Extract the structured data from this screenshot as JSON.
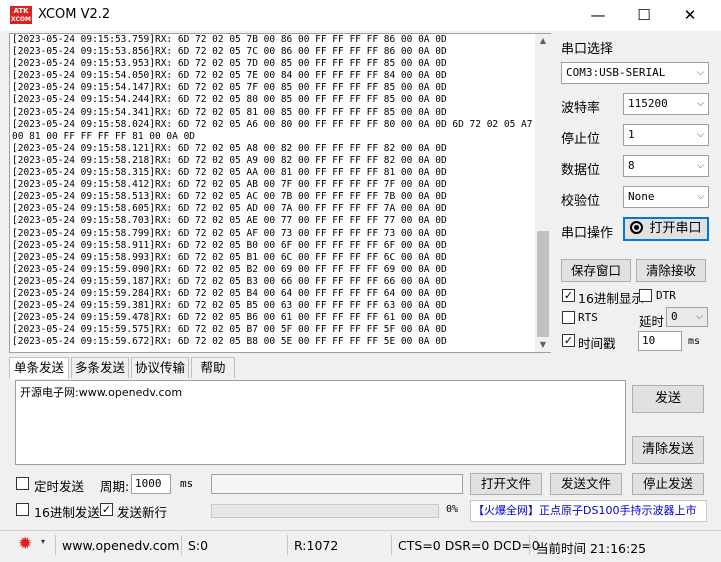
{
  "window": {
    "logo_text": "ATK",
    "logo_sub": "XCOM",
    "title": "XCOM V2.2",
    "min_glyph": "—",
    "max_glyph": "☐",
    "close_glyph": "✕"
  },
  "receive_lines": [
    "[2023-05-24 09:15:53.759]RX: 6D 72 02 05 7B 00 86 00 FF FF FF FF 86 00 0A 0D",
    "[2023-05-24 09:15:53.856]RX: 6D 72 02 05 7C 00 86 00 FF FF FF FF 86 00 0A 0D",
    "[2023-05-24 09:15:53.953]RX: 6D 72 02 05 7D 00 85 00 FF FF FF FF 85 00 0A 0D",
    "[2023-05-24 09:15:54.050]RX: 6D 72 02 05 7E 00 84 00 FF FF FF FF 84 00 0A 0D",
    "[2023-05-24 09:15:54.147]RX: 6D 72 02 05 7F 00 85 00 FF FF FF FF 85 00 0A 0D",
    "[2023-05-24 09:15:54.244]RX: 6D 72 02 05 80 00 85 00 FF FF FF FF 85 00 0A 0D",
    "[2023-05-24 09:15:54.341]RX: 6D 72 02 05 81 00 85 00 FF FF FF FF 85 00 0A 0D",
    "[2023-05-24 09:15:58.024]RX: 6D 72 02 05 A6 00 80 00 FF FF FF FF 80 00 0A 0D 6D 72 02 05 A7 00 81 00 FF FF FF FF 81 00 0A 0D",
    "[2023-05-24 09:15:58.121]RX: 6D 72 02 05 A8 00 82 00 FF FF FF FF 82 00 0A 0D",
    "[2023-05-24 09:15:58.218]RX: 6D 72 02 05 A9 00 82 00 FF FF FF FF 82 00 0A 0D",
    "[2023-05-24 09:15:58.315]RX: 6D 72 02 05 AA 00 81 00 FF FF FF FF 81 00 0A 0D",
    "[2023-05-24 09:15:58.412]RX: 6D 72 02 05 AB 00 7F 00 FF FF FF FF 7F 00 0A 0D",
    "[2023-05-24 09:15:58.513]RX: 6D 72 02 05 AC 00 7B 00 FF FF FF FF 7B 00 0A 0D",
    "[2023-05-24 09:15:58.605]RX: 6D 72 02 05 AD 00 7A 00 FF FF FF FF 7A 00 0A 0D",
    "[2023-05-24 09:15:58.703]RX: 6D 72 02 05 AE 00 77 00 FF FF FF FF 77 00 0A 0D",
    "[2023-05-24 09:15:58.799]RX: 6D 72 02 05 AF 00 73 00 FF FF FF FF 73 00 0A 0D",
    "[2023-05-24 09:15:58.911]RX: 6D 72 02 05 B0 00 6F 00 FF FF FF FF 6F 00 0A 0D",
    "[2023-05-24 09:15:58.993]RX: 6D 72 02 05 B1 00 6C 00 FF FF FF FF 6C 00 0A 0D",
    "[2023-05-24 09:15:59.090]RX: 6D 72 02 05 B2 00 69 00 FF FF FF FF 69 00 0A 0D",
    "[2023-05-24 09:15:59.187]RX: 6D 72 02 05 B3 00 66 00 FF FF FF FF 66 00 0A 0D",
    "[2023-05-24 09:15:59.284]RX: 6D 72 02 05 B4 00 64 00 FF FF FF FF 64 00 0A 0D",
    "[2023-05-24 09:15:59.381]RX: 6D 72 02 05 B5 00 63 00 FF FF FF FF 63 00 0A 0D",
    "[2023-05-24 09:15:59.478]RX: 6D 72 02 05 B6 00 61 00 FF FF FF FF 61 00 0A 0D",
    "[2023-05-24 09:15:59.575]RX: 6D 72 02 05 B7 00 5F 00 FF FF FF FF 5F 00 0A 0D",
    "[2023-05-24 09:15:59.672]RX: 6D 72 02 05 B8 00 5E 00 FF FF FF FF 5E 00 0A 0D"
  ],
  "panel": {
    "port_label": "串口选择",
    "port_value": "COM3:USB-SERIAL",
    "baud_label": "波特率",
    "baud_value": "115200",
    "stop_label": "停止位",
    "stop_value": "1",
    "data_label": "数据位",
    "data_value": "8",
    "parity_label": "校验位",
    "parity_value": "None",
    "op_label": "串口操作",
    "open_port_button": "打开串口",
    "save_window_button": "保存窗口",
    "clear_receive_button": "清除接收",
    "hex_display_label": "16进制显示",
    "hex_display_checked": true,
    "dtr_label": "DTR",
    "dtr_checked": false,
    "rts_label": "RTS",
    "rts_checked": false,
    "delay_label": "延时",
    "delay_value": "0",
    "timestamp_label": "时间戳",
    "timestamp_checked": true,
    "timestamp_value": "10",
    "timestamp_unit": "ms"
  },
  "tabs": [
    "单条发送",
    "多条发送",
    "协议传输",
    "帮助"
  ],
  "send": {
    "text": "开源电子网:www.openedv.com",
    "send_button": "发送",
    "clear_send_button": "清除发送"
  },
  "bottom": {
    "timed_send_label": "定时发送",
    "timed_send_checked": false,
    "period_label": "周期:",
    "period_value": "1000",
    "period_unit": "ms",
    "open_file_button": "打开文件",
    "send_file_button": "发送文件",
    "stop_send_button": "停止发送",
    "hex_send_label": "16进制发送",
    "hex_send_checked": false,
    "send_newline_label": "发送新行",
    "send_newline_checked": true,
    "progress_percent": "0%",
    "ad_text": "【火爆全网】正点原子DS100手持示波器上市"
  },
  "status": {
    "gear_icon": "gear-icon",
    "url": "www.openedv.com",
    "sent": "S:0",
    "received": "R:1072",
    "signals": "CTS=0 DSR=0 DCD=0",
    "time": "当前时间 21:16:25"
  },
  "colors": {
    "ad_text": "#0000cc",
    "gear": "#e02020"
  }
}
